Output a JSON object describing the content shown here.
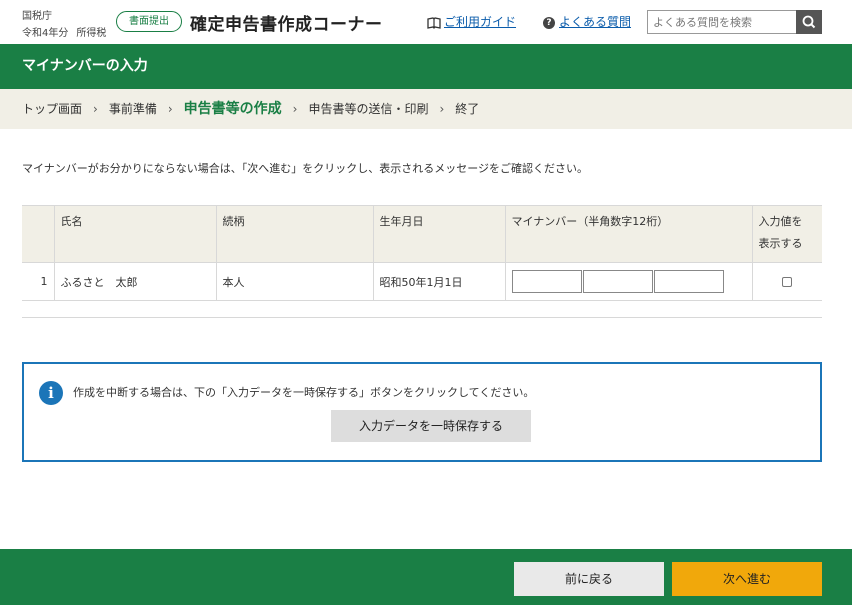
{
  "header": {
    "agency": "国税庁",
    "tax_year": "令和4年分",
    "tax_type": "所得税",
    "badge": "書面提出",
    "app_title": "確定申告書作成コーナー",
    "guide_link": "ご利用ガイド",
    "faq_link": "よくある質問",
    "search_placeholder": "よくある質問を検索"
  },
  "page_title": "マイナンバーの入力",
  "breadcrumb": {
    "items": [
      "トップ画面",
      "事前準備",
      "申告書等の作成",
      "申告書等の送信・印刷",
      "終了"
    ],
    "current_index": 2
  },
  "instruction": "マイナンバーがお分かりにならない場合は、「次へ進む」をクリックし、表示されるメッセージをご確認ください。",
  "table": {
    "headers": {
      "name": "氏名",
      "relation": "続柄",
      "dob": "生年月日",
      "my_number": "マイナンバー（半角数字12桁）",
      "show_line1": "入力値を",
      "show_line2": "表示する"
    },
    "rows": [
      {
        "no": "1",
        "name": "ふるさと　太郎",
        "relation": "本人",
        "dob": "昭和50年1月1日",
        "my_number": [
          "",
          "",
          ""
        ],
        "show": false
      }
    ]
  },
  "info": {
    "text": "作成を中断する場合は、下の「入力データを一時保存する」ボタンをクリックしてください。",
    "save_button": "入力データを一時保存する"
  },
  "footer": {
    "back": "前に戻る",
    "next": "次へ進む"
  },
  "colors": {
    "brand_green": "#1a7f45",
    "accent_orange": "#f1a80b",
    "info_blue": "#1b75b8",
    "breadcrumb_bg": "#f1efe6"
  }
}
